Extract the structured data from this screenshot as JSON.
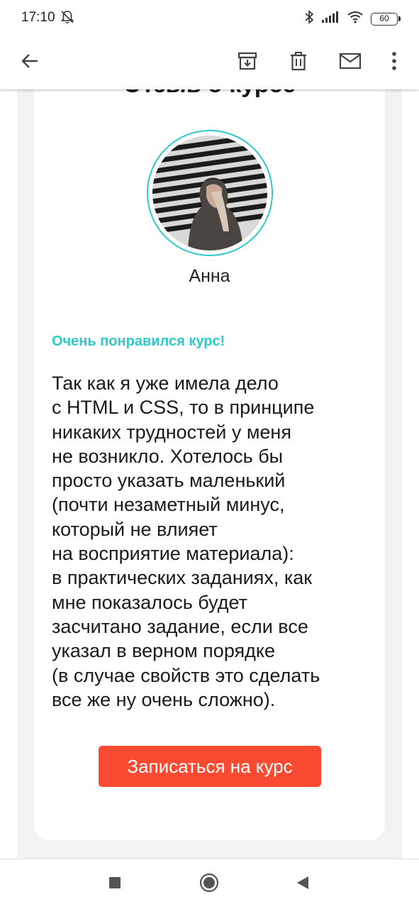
{
  "status_bar": {
    "time": "17:10",
    "battery": "60"
  },
  "toolbar": {
    "back_icon": "arrow-left-icon",
    "archive_icon": "archive-icon",
    "delete_icon": "trash-icon",
    "mark_unread_icon": "mail-icon",
    "more_icon": "more-vertical-icon"
  },
  "email": {
    "heading": "Отзыв о курсе",
    "reviewer_name": "Анна",
    "review_title": "Очень понравился курс!",
    "review_body": "Так как я уже имела дело\nс HTML и CSS, то в принципе\nникаких трудностей у меня\nне возникло. Хотелось бы\nпросто указать маленький\n(почти незаметный минус,\nкоторый не влияет\nна восприятие материала):\nв практических заданиях, как\nмне показалось будет\nзасчитано задание, если все\nуказал в верном порядке\n(в случае свойств это сделать\nвсе же ну очень сложно).",
    "cta_label": "Записаться на курс"
  },
  "colors": {
    "accent_teal": "#2ec9c9",
    "cta_red": "#fb4a32",
    "content_bg": "#f2f2f2"
  }
}
